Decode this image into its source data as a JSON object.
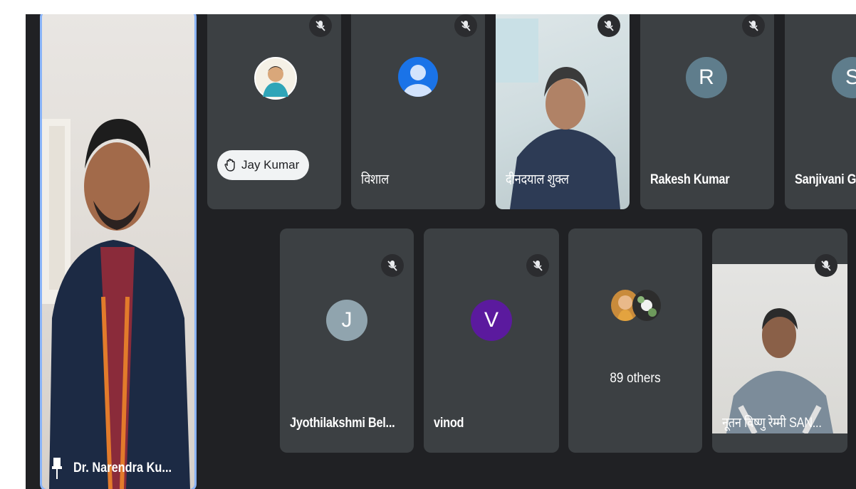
{
  "pinned": {
    "name": "Dr. Narendra Ku...",
    "pin_icon": "pin-icon",
    "highlight_color": "#8ab4f8"
  },
  "tiles": {
    "jay": {
      "name": "Jay Kumar",
      "hand_icon": "raised-hand-icon"
    },
    "vishal": {
      "name": "विशाल"
    },
    "deendayal": {
      "name": "दीनदयाल शुक्ल"
    },
    "rakesh": {
      "name": "Rakesh Kumar",
      "initial": "R",
      "avatar_color": "#5f7d8c"
    },
    "sanjivani": {
      "name": "Sanjivani G",
      "initial": "S",
      "avatar_color": "#5f7d8c"
    },
    "jyothi": {
      "name": "Jyothilakshmi Bel...",
      "initial": "J",
      "avatar_color": "#90a4ae"
    },
    "vinod": {
      "name": "vinod",
      "initial": "V",
      "avatar_color": "#5b1a9e"
    },
    "others": {
      "label": "89 others"
    },
    "nutan": {
      "name": "नूतन विष्णु रेम्मी SAN..."
    }
  },
  "icons": {
    "mute": "mic-off-icon"
  }
}
